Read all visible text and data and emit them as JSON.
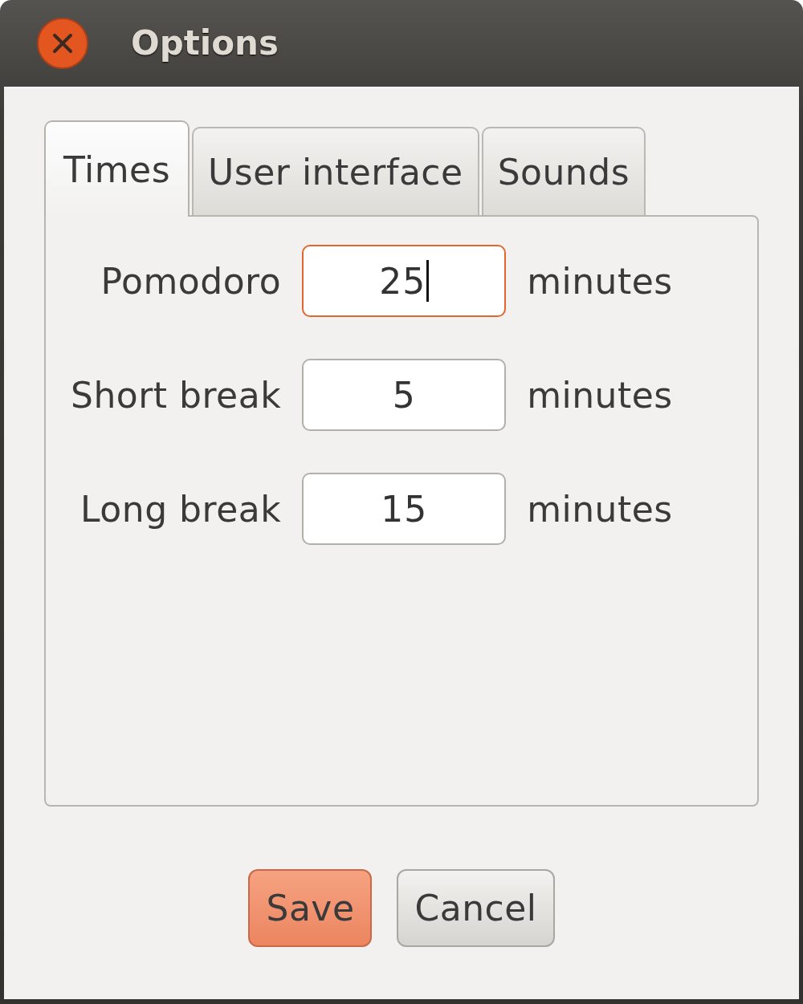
{
  "window": {
    "title": "Options"
  },
  "tabs": [
    {
      "label": "Times",
      "selected": true
    },
    {
      "label": "User interface",
      "selected": false
    },
    {
      "label": "Sounds",
      "selected": false
    }
  ],
  "fields": [
    {
      "label": "Pomodoro",
      "value": "25",
      "unit": "minutes",
      "focused": true
    },
    {
      "label": "Short break",
      "value": "5",
      "unit": "minutes",
      "focused": false
    },
    {
      "label": "Long break",
      "value": "15",
      "unit": "minutes",
      "focused": false
    }
  ],
  "buttons": [
    {
      "label": "Save",
      "default": true
    },
    {
      "label": "Cancel",
      "default": false
    }
  ]
}
